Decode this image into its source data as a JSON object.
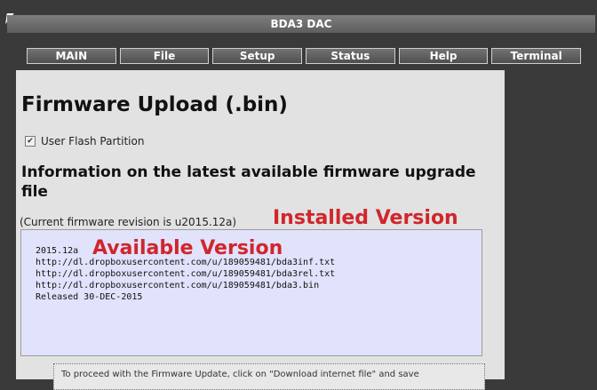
{
  "window": {
    "title": "BDA3 DAC"
  },
  "nav": {
    "tabs": [
      "MAIN",
      "File",
      "Setup",
      "Status",
      "Help",
      "Terminal"
    ]
  },
  "page": {
    "title": "Firmware Upload (.bin)",
    "checkbox_label": "User Flash Partition",
    "checkbox_checked": true,
    "section_heading": "Information on the latest available firmware upgrade file",
    "current_revision_text": "(Current firmware revision is u2015.12a)",
    "installed_annotation": "Installed Version",
    "available_annotation": "Available Version",
    "panel_lines": [
      "2015.12a",
      "http://dl.dropboxusercontent.com/u/189059481/bda3inf.txt",
      "http://dl.dropboxusercontent.com/u/189059481/bda3rel.txt",
      "http://dl.dropboxusercontent.com/u/189059481/bda3.bin",
      "Released 30-DEC-2015"
    ],
    "notice_text": "To proceed with the Firmware Update, click on \"Download internet file\" and save"
  },
  "colors": {
    "annotation": "#d0262c",
    "panel_bg": "#e1e2fb"
  }
}
